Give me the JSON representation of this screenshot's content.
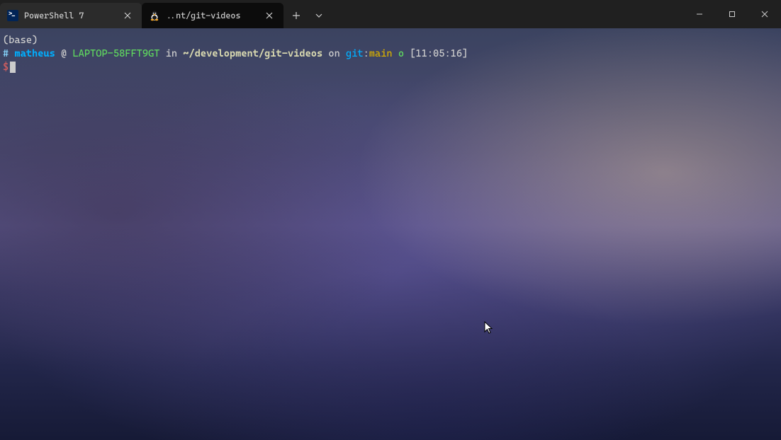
{
  "titlebar": {
    "tabs": [
      {
        "label": "PowerShell 7",
        "active": false,
        "icon": "powershell"
      },
      {
        "label": "..nt/git-videos",
        "active": true,
        "icon": "tux"
      }
    ]
  },
  "terminal": {
    "env": "(base)",
    "hash": "#",
    "user": "matheus",
    "at": "@",
    "host": "LAPTOP-58FFT9GT",
    "in_kw": "in",
    "path": "~/development/git-videos",
    "on_kw": "on",
    "git_kw": "git",
    "colon": ":",
    "branch": "main",
    "clean": "o",
    "time": "[11:05:16]",
    "prompt_sym": "$"
  }
}
